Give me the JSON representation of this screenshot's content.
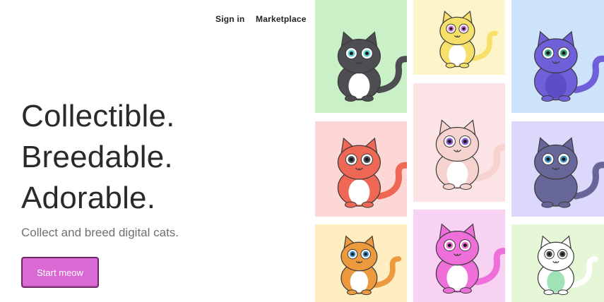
{
  "nav": {
    "sign_in": "Sign in",
    "marketplace": "Marketplace"
  },
  "hero": {
    "lines": [
      "Collectible.",
      "Breedable.",
      "Adorable."
    ],
    "subtitle": "Collect and breed digital cats.",
    "cta_label": "Start meow"
  },
  "colors": {
    "cta_bg": "#da6ad3",
    "cta_border": "#6e2766",
    "headline": "#2a2a2a",
    "subtitle": "#6f6f6f"
  },
  "cats": [
    {
      "name": "grey-striped-cat",
      "tile_bg": "#c9f0c6",
      "fur": "#4d4d52",
      "belly": "#ffffff",
      "eyes": "#5fd0d6"
    },
    {
      "name": "yellow-cat",
      "tile_bg": "#fdf5c9",
      "fur": "#f6e06a",
      "belly": "#ffffff",
      "eyes": "#d26be0"
    },
    {
      "name": "purple-spotted-cat",
      "tile_bg": "#cde3fb",
      "fur": "#6f5fd9",
      "belly": "#5c4ec4",
      "eyes": "#3aa17a"
    },
    {
      "name": "pink-white-cat",
      "tile_bg": "#fbe3e6",
      "fur": "#f7d3d0",
      "belly": "#ffffff",
      "eyes": "#8b5bd1"
    },
    {
      "name": "red-cat",
      "tile_bg": "#fdd6d6",
      "fur": "#ef6755",
      "belly": "#ffffff",
      "eyes": "#4d4d52"
    },
    {
      "name": "slate-cat",
      "tile_bg": "#dcd8fb",
      "fur": "#666699",
      "belly": "#666699",
      "eyes": "#3e8fbf"
    },
    {
      "name": "orange-cat",
      "tile_bg": "#fdedc0",
      "fur": "#ec9a3d",
      "belly": "#ffffff",
      "eyes": "#3b8fd0"
    },
    {
      "name": "magenta-cat",
      "tile_bg": "#f8d2f3",
      "fur": "#ee6fd9",
      "belly": "#ffffff",
      "eyes": "#ec6fd0"
    },
    {
      "name": "mint-cat",
      "tile_bg": "#e5f7d6",
      "fur": "#ffffff",
      "belly": "#9fe3b7",
      "eyes": "#4d4d52"
    }
  ]
}
